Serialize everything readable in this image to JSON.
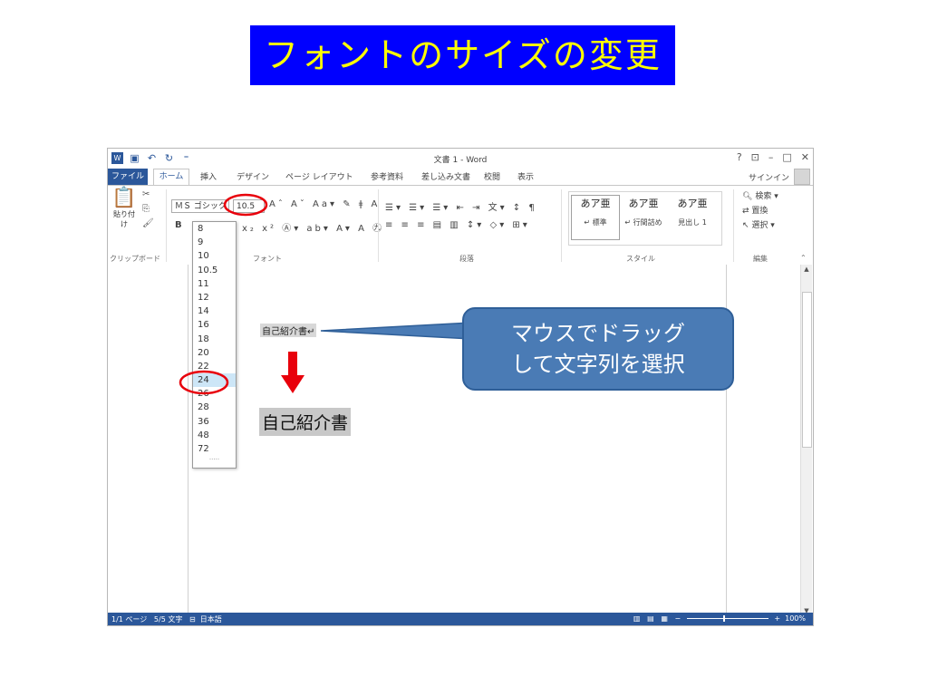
{
  "slide_title": "フォントのサイズの変更",
  "window": {
    "title": "文書 1 - Word",
    "controls": [
      "?",
      "⊡",
      "–",
      "□",
      "✕"
    ]
  },
  "tabs": {
    "file": "ファイル",
    "home": "ホーム",
    "insert": "挿入",
    "design": "デザイン",
    "layout": "ページ レイアウト",
    "references": "参考資料",
    "mailings": "差し込み文書",
    "review": "校閲",
    "view": "表示",
    "signin": "サインイン"
  },
  "ribbon": {
    "paste_label": "貼り付け",
    "font_name": "ＭＳ ゴシック",
    "font_size": "10.5",
    "group_clipboard": "クリップボード",
    "group_font": "フォント",
    "group_paragraph": "段落",
    "group_styles": "スタイル",
    "group_editing": "編集",
    "styles": [
      {
        "preview": "あア亜",
        "name": "↵ 標準"
      },
      {
        "preview": "あア亜",
        "name": "↵ 行間詰め"
      },
      {
        "preview": "あア亜",
        "name": "見出し 1"
      }
    ],
    "editing": [
      "検索",
      "置換",
      "選択"
    ]
  },
  "font_size_options": [
    "8",
    "9",
    "10",
    "10.5",
    "11",
    "12",
    "14",
    "16",
    "18",
    "20",
    "22",
    "24",
    "26",
    "28",
    "36",
    "48",
    "72"
  ],
  "selected_size": "24",
  "document": {
    "small_text": "自己紹介書↵",
    "big_text": "自己紹介書"
  },
  "callout": {
    "line1": "マウスでドラッグ",
    "line2": "して文字列を選択"
  },
  "status": {
    "page": "1/1 ページ",
    "words": "5/5 文字",
    "lang": "日本語",
    "zoom": "100%"
  },
  "colors": {
    "title_bg": "#0000ff",
    "title_fg": "#ffff00",
    "word_blue": "#2b579a",
    "callout": "#4a7bb5",
    "highlight_circle": "#e8000b",
    "arrow": "#e8000b"
  }
}
